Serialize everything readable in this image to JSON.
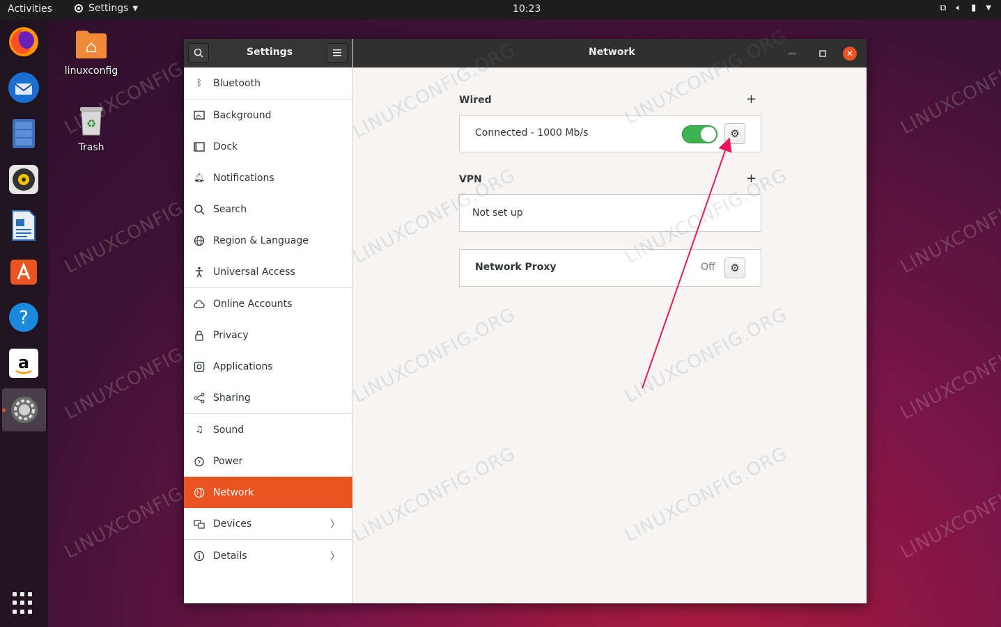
{
  "topbar": {
    "activities": "Activities",
    "app_menu": "Settings",
    "clock": "10:23"
  },
  "desktop": {
    "home_label": "linuxconfig",
    "trash_label": "Trash"
  },
  "dock": {
    "apps": [
      "firefox-icon",
      "thunderbird-icon",
      "files-icon",
      "rhythmbox-icon",
      "writer-icon",
      "software-icon",
      "help-icon",
      "amazon-icon",
      "settings-icon"
    ]
  },
  "window": {
    "sidebar_title": "Settings",
    "content_title": "Network"
  },
  "sidebar": {
    "items": [
      {
        "label": "Bluetooth",
        "icon": "bluetooth-icon"
      },
      {
        "label": "Background",
        "icon": "background-icon"
      },
      {
        "label": "Dock",
        "icon": "dock-icon"
      },
      {
        "label": "Notifications",
        "icon": "bell-icon"
      },
      {
        "label": "Search",
        "icon": "search-icon"
      },
      {
        "label": "Region & Language",
        "icon": "globe-icon"
      },
      {
        "label": "Universal Access",
        "icon": "accessibility-icon"
      },
      {
        "label": "Online Accounts",
        "icon": "cloud-icon"
      },
      {
        "label": "Privacy",
        "icon": "lock-icon"
      },
      {
        "label": "Applications",
        "icon": "applications-icon"
      },
      {
        "label": "Sharing",
        "icon": "share-icon"
      },
      {
        "label": "Sound",
        "icon": "music-note-icon"
      },
      {
        "label": "Power",
        "icon": "power-icon"
      },
      {
        "label": "Network",
        "icon": "network-icon"
      },
      {
        "label": "Devices",
        "icon": "devices-icon"
      },
      {
        "label": "Details",
        "icon": "info-icon"
      }
    ],
    "selected": "Network"
  },
  "network": {
    "wired_title": "Wired",
    "wired_status": "Connected - 1000 Mb/s",
    "wired_enabled": true,
    "vpn_title": "VPN",
    "vpn_status": "Not set up",
    "proxy_title": "Network Proxy",
    "proxy_status": "Off"
  },
  "watermark": "LINUXCONFIG.ORG",
  "colors": {
    "accent": "#e95420",
    "toggle_on": "#3eb34f",
    "annotation_arrow": "#e8175d"
  }
}
